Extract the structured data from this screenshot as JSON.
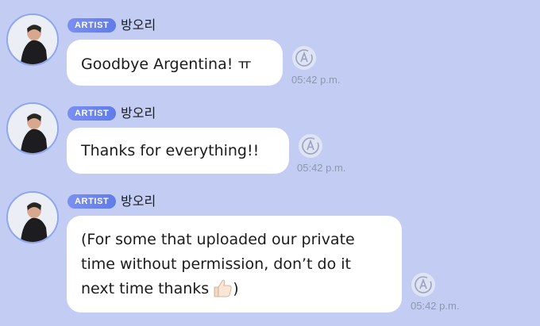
{
  "messages": [
    {
      "badge": "ARTIST",
      "sender": "방오리",
      "lines": [
        "Goodbye Argentina! ㅠ"
      ],
      "time": "05:42 p.m.",
      "read_icon": "read-receipt-a-icon"
    },
    {
      "badge": "ARTIST",
      "sender": "방오리",
      "lines": [
        "Thanks for everything!!"
      ],
      "time": "05:42 p.m.",
      "read_icon": "read-receipt-a-icon"
    },
    {
      "badge": "ARTIST",
      "sender": "방오리",
      "lines": [
        "(For some that uploaded our private",
        "time without permission, don’t do it",
        "next time thanks"
      ],
      "closing": ")",
      "emoji": "thumbs-up-icon",
      "time": "05:42 p.m.",
      "read_icon": "read-receipt-a-icon"
    }
  ],
  "colors": {
    "background": "#c3cdf4",
    "badge": "#6d84ec",
    "bubble": "#ffffff",
    "timestamp": "#8d97ad"
  }
}
